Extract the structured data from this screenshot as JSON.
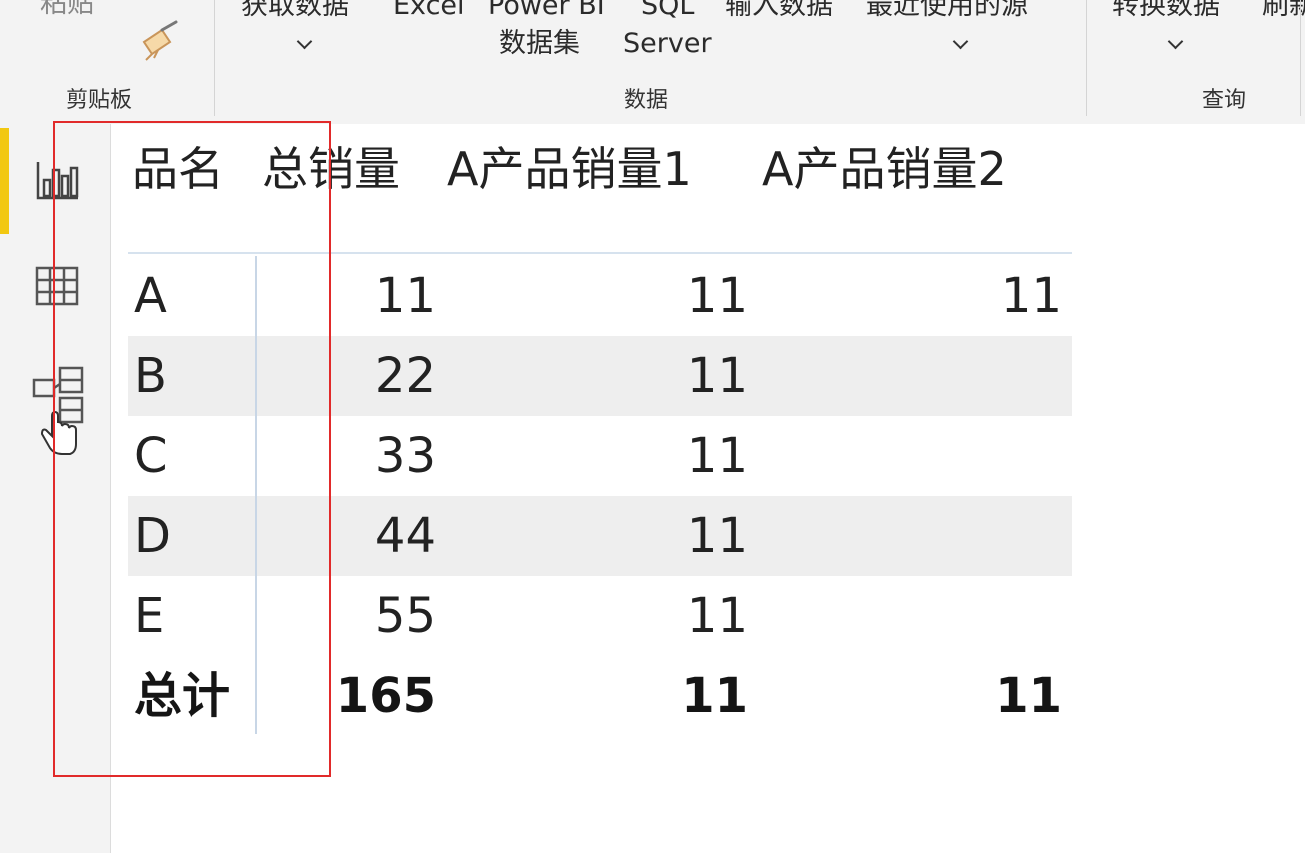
{
  "ribbon": {
    "clipboard": {
      "paste_label": "粘贴",
      "group_label": "剪贴板"
    },
    "data": {
      "get_data_label": "获取数据",
      "excel_label": "Excel",
      "powerbi_label_1": "Power BI",
      "powerbi_label_2": "数据集",
      "sql_label_1": "SQL",
      "sql_label_2": "Server",
      "enter_data_label": "输入数据",
      "recent_sources_label": "最近使用的源",
      "group_label": "数据"
    },
    "query": {
      "transform_label": "转换数据",
      "refresh_label": "刷新",
      "group_label": "查询"
    }
  },
  "table": {
    "headers": [
      "品名",
      "总销量",
      "A产品销量1",
      "A产品销量2"
    ],
    "rows": [
      {
        "name": "A",
        "total": "11",
        "a1": "11",
        "a2": "11"
      },
      {
        "name": "B",
        "total": "22",
        "a1": "11",
        "a2": ""
      },
      {
        "name": "C",
        "total": "33",
        "a1": "11",
        "a2": ""
      },
      {
        "name": "D",
        "total": "44",
        "a1": "11",
        "a2": ""
      },
      {
        "name": "E",
        "total": "55",
        "a1": "11",
        "a2": ""
      }
    ],
    "total_row": {
      "name": "总计",
      "total": "165",
      "a1": "11",
      "a2": "11"
    }
  },
  "colors": {
    "accent": "#f2c811",
    "annotation": "#e12a2a",
    "row_shade": "#eeeeee"
  }
}
